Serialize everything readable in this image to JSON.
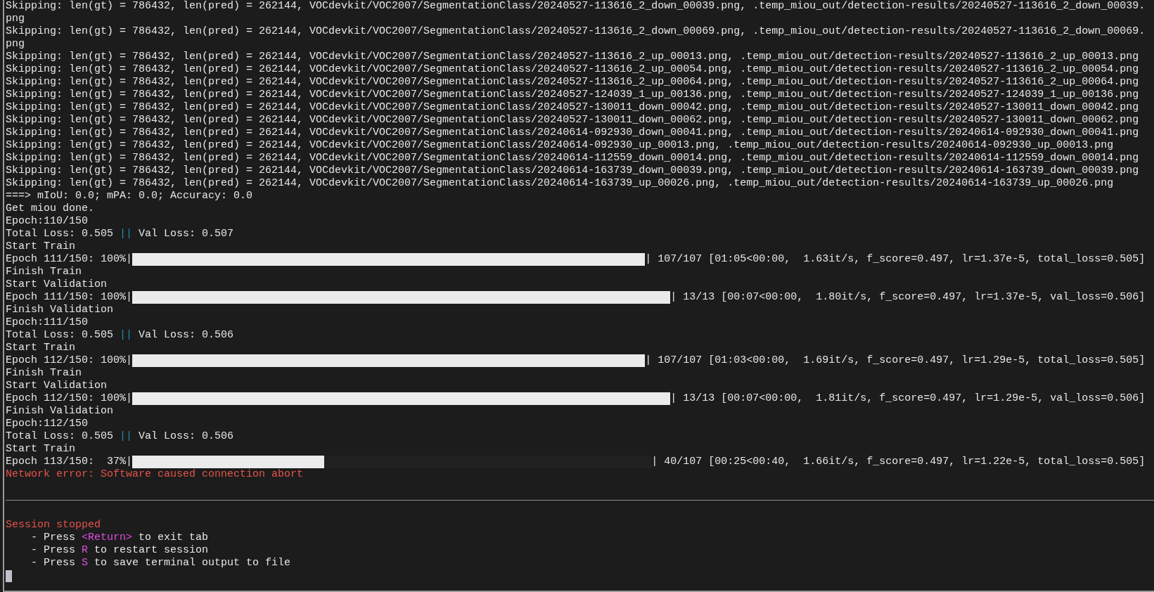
{
  "terminal": {
    "lines": [
      {
        "kind": "text",
        "text": "Skipping: len(gt) = 786432, len(pred) = 262144, VOCdevkit/VOC2007/SegmentationClass/20240527-113616_2_down_00039.png, .temp_miou_out/detection-results/20240527-113616_2_down_00039.png"
      },
      {
        "kind": "text",
        "text": "Skipping: len(gt) = 786432, len(pred) = 262144, VOCdevkit/VOC2007/SegmentationClass/20240527-113616_2_down_00069.png, .temp_miou_out/detection-results/20240527-113616_2_down_00069.png"
      },
      {
        "kind": "text",
        "text": "Skipping: len(gt) = 786432, len(pred) = 262144, VOCdevkit/VOC2007/SegmentationClass/20240527-113616_2_up_00013.png, .temp_miou_out/detection-results/20240527-113616_2_up_00013.png"
      },
      {
        "kind": "text",
        "text": "Skipping: len(gt) = 786432, len(pred) = 262144, VOCdevkit/VOC2007/SegmentationClass/20240527-113616_2_up_00054.png, .temp_miou_out/detection-results/20240527-113616_2_up_00054.png"
      },
      {
        "kind": "text",
        "text": "Skipping: len(gt) = 786432, len(pred) = 262144, VOCdevkit/VOC2007/SegmentationClass/20240527-113616_2_up_00064.png, .temp_miou_out/detection-results/20240527-113616_2_up_00064.png"
      },
      {
        "kind": "text",
        "text": "Skipping: len(gt) = 786432, len(pred) = 262144, VOCdevkit/VOC2007/SegmentationClass/20240527-124039_1_up_00136.png, .temp_miou_out/detection-results/20240527-124039_1_up_00136.png"
      },
      {
        "kind": "text",
        "text": "Skipping: len(gt) = 786432, len(pred) = 262144, VOCdevkit/VOC2007/SegmentationClass/20240527-130011_down_00042.png, .temp_miou_out/detection-results/20240527-130011_down_00042.png"
      },
      {
        "kind": "text",
        "text": "Skipping: len(gt) = 786432, len(pred) = 262144, VOCdevkit/VOC2007/SegmentationClass/20240527-130011_down_00062.png, .temp_miou_out/detection-results/20240527-130011_down_00062.png"
      },
      {
        "kind": "text",
        "text": "Skipping: len(gt) = 786432, len(pred) = 262144, VOCdevkit/VOC2007/SegmentationClass/20240614-092930_down_00041.png, .temp_miou_out/detection-results/20240614-092930_down_00041.png"
      },
      {
        "kind": "text",
        "text": "Skipping: len(gt) = 786432, len(pred) = 262144, VOCdevkit/VOC2007/SegmentationClass/20240614-092930_up_00013.png, .temp_miou_out/detection-results/20240614-092930_up_00013.png"
      },
      {
        "kind": "text",
        "text": "Skipping: len(gt) = 786432, len(pred) = 262144, VOCdevkit/VOC2007/SegmentationClass/20240614-112559_down_00014.png, .temp_miou_out/detection-results/20240614-112559_down_00014.png"
      },
      {
        "kind": "text",
        "text": "Skipping: len(gt) = 786432, len(pred) = 262144, VOCdevkit/VOC2007/SegmentationClass/20240614-163739_down_00039.png, .temp_miou_out/detection-results/20240614-163739_down_00039.png"
      },
      {
        "kind": "text",
        "text": "Skipping: len(gt) = 786432, len(pred) = 262144, VOCdevkit/VOC2007/SegmentationClass/20240614-163739_up_00026.png, .temp_miou_out/detection-results/20240614-163739_up_00026.png"
      },
      {
        "kind": "text",
        "text": "===> mIoU: 0.0; mPA: 0.0; Accuracy: 0.0"
      },
      {
        "kind": "text",
        "text": "Get miou done."
      },
      {
        "kind": "text",
        "text": "Epoch:110/150"
      },
      {
        "kind": "loss",
        "parts": [
          {
            "kind": "plain",
            "text": "Total Loss: 0.505"
          },
          {
            "kind": "separator",
            "text": "||"
          },
          {
            "kind": "plain",
            "text": "Val Loss: 0.507"
          }
        ]
      },
      {
        "kind": "text",
        "text": "Start Train"
      },
      {
        "kind": "progress",
        "prefix": "Epoch 111/150: 100%|",
        "level": 1,
        "suffix": "| 107/107 [01:05<00:00,  1.63it/s, f_score=0.497, lr=1.37e-5, total_loss=0.505]"
      },
      {
        "kind": "text",
        "text": "Finish Train"
      },
      {
        "kind": "text",
        "text": "Start Validation"
      },
      {
        "kind": "progress",
        "prefix": "Epoch 111/150: 100%|",
        "level": 1,
        "suffix": "| 13/13 [00:07<00:00,  1.80it/s, f_score=0.497, lr=1.37e-5, val_loss=0.506]"
      },
      {
        "kind": "text",
        "text": "Finish Validation"
      },
      {
        "kind": "text",
        "text": "Epoch:111/150"
      },
      {
        "kind": "loss",
        "parts": [
          {
            "kind": "plain",
            "text": "Total Loss: 0.505"
          },
          {
            "kind": "separator",
            "text": "||"
          },
          {
            "kind": "plain",
            "text": "Val Loss: 0.506"
          }
        ]
      },
      {
        "kind": "text",
        "text": "Start Train"
      },
      {
        "kind": "progress",
        "prefix": "Epoch 112/150: 100%|",
        "level": 1,
        "suffix": "| 107/107 [01:03<00:00,  1.69it/s, f_score=0.497, lr=1.29e-5, total_loss=0.505]"
      },
      {
        "kind": "text",
        "text": "Finish Train"
      },
      {
        "kind": "text",
        "text": "Start Validation"
      },
      {
        "kind": "progress",
        "prefix": "Epoch 112/150: 100%|",
        "level": 1,
        "suffix": "| 13/13 [00:07<00:00,  1.81it/s, f_score=0.497, lr=1.29e-5, val_loss=0.506]"
      },
      {
        "kind": "text",
        "text": "Finish Validation"
      },
      {
        "kind": "text",
        "text": "Epoch:112/150"
      },
      {
        "kind": "loss",
        "parts": [
          {
            "kind": "plain",
            "text": "Total Loss: 0.505"
          },
          {
            "kind": "separator",
            "text": "||"
          },
          {
            "kind": "plain",
            "text": "Val Loss: 0.506"
          }
        ]
      },
      {
        "kind": "text",
        "text": "Start Train"
      },
      {
        "kind": "progress",
        "prefix": "Epoch 113/150:  37%|",
        "level": 0.37,
        "suffix": "| 40/107 [00:25<00:40,  1.66it/s, f_score=0.497, lr=1.22e-5, total_loss=0.505]"
      },
      {
        "kind": "error",
        "text": "Network error: Software caused connection abort"
      },
      {
        "kind": "rule"
      },
      {
        "kind": "error",
        "text": "Session stopped"
      },
      {
        "kind": "hint",
        "parts": [
          {
            "kind": "plain",
            "text": "- Press"
          },
          {
            "kind": "key",
            "text": "<Return>"
          },
          {
            "kind": "plain",
            "text": "to exit tab"
          }
        ]
      },
      {
        "kind": "hint",
        "parts": [
          {
            "kind": "plain",
            "text": "- Press"
          },
          {
            "kind": "key",
            "text": "R"
          },
          {
            "kind": "plain",
            "text": "to restart session"
          }
        ]
      },
      {
        "kind": "hint",
        "parts": [
          {
            "kind": "plain",
            "text": "- Press"
          },
          {
            "kind": "key",
            "text": "S"
          },
          {
            "kind": "plain",
            "text": "to save terminal output to file"
          }
        ]
      },
      {
        "kind": "cursor"
      }
    ]
  }
}
